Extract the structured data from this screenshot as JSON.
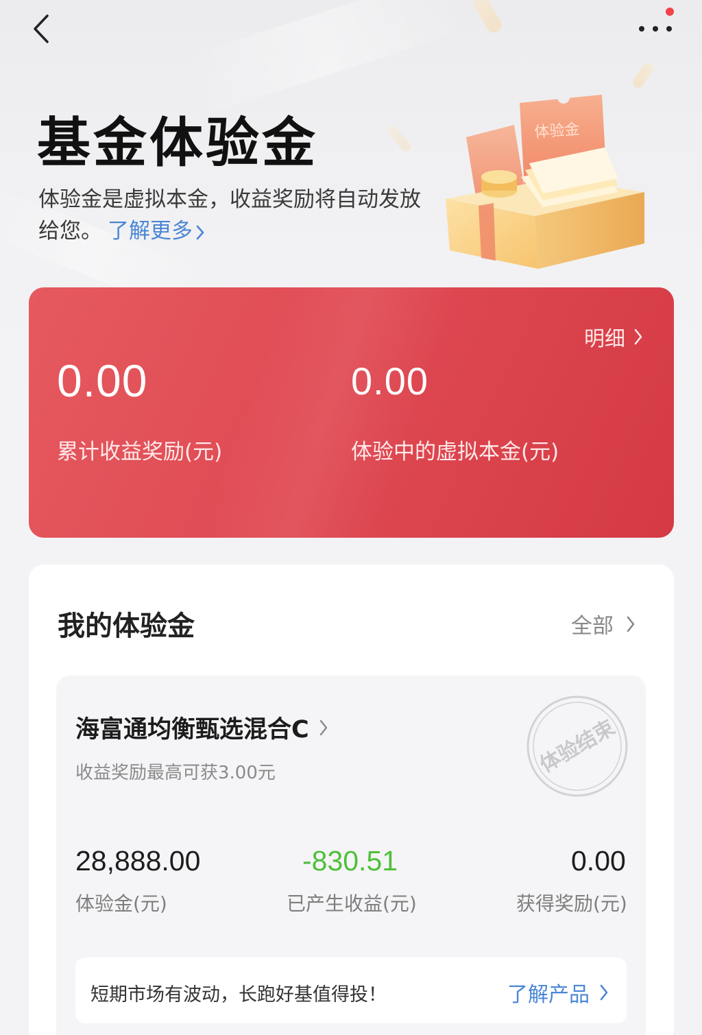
{
  "header": {
    "title": "基金体验金",
    "intro_text": "体验金是虚拟本金，收益奖励将自动发放给您。",
    "learn_more": "了解更多",
    "illustration_label": "体验金",
    "has_notification": true
  },
  "summary": {
    "detail_label": "明细",
    "cumulative_reward_value": "0.00",
    "cumulative_reward_label": "累计收益奖励(元)",
    "virtual_principal_value": "0.00",
    "virtual_principal_label": "体验中的虚拟本金(元)"
  },
  "my_funds": {
    "title": "我的体验金",
    "all_label": "全部",
    "fund": {
      "name": "海富通均衡甄选混合C",
      "max_reward": "收益奖励最高可获3.00元",
      "stamp": "体验结束",
      "experience_amount": "28,888.00",
      "experience_amount_label": "体验金(元)",
      "generated_profit": "-830.51",
      "generated_profit_label": "已产生收益(元)",
      "reward_earned": "0.00",
      "reward_earned_label": "获得奖励(元)"
    },
    "tip": "短期市场有波动，长跑好基值得投！",
    "product_link": "了解产品"
  },
  "colors": {
    "accent_red": "#e04a53",
    "link_blue": "#4a86d6",
    "profit_green": "#4fbf3a",
    "notification_dot": "#f0434b"
  }
}
